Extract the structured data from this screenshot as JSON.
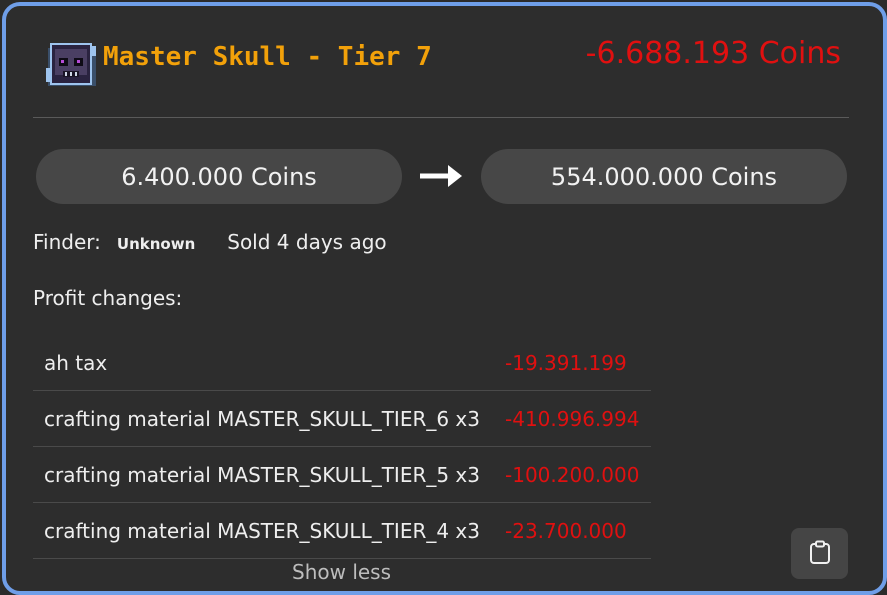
{
  "item": {
    "icon": "master-skull-icon",
    "title": "Master Skull - Tier 7",
    "profit": "-6.688.193 Coins"
  },
  "trade": {
    "buy_price": "6.400.000 Coins",
    "sell_price": "554.000.000 Coins",
    "arrow_icon": "arrow-right-icon"
  },
  "info": {
    "finder_label": "Finder:",
    "finder_value": "Unknown",
    "sold_text": "Sold 4 days ago"
  },
  "profit_changes": {
    "label": "Profit changes:",
    "rows": [
      {
        "label": "ah tax",
        "value": "-19.391.199"
      },
      {
        "label": "crafting material MASTER_SKULL_TIER_6 x3",
        "value": "-410.996.994"
      },
      {
        "label": "crafting material MASTER_SKULL_TIER_5 x3",
        "value": "-100.200.000"
      },
      {
        "label": "crafting material MASTER_SKULL_TIER_4 x3",
        "value": "-23.700.000"
      }
    ],
    "toggle_label": "Show less"
  },
  "copy_button": {
    "icon": "clipboard-icon"
  },
  "colors": {
    "accent_border": "#6f9ee8",
    "title": "#f2a10a",
    "negative": "#e01010",
    "background": "#2d2d2d"
  }
}
